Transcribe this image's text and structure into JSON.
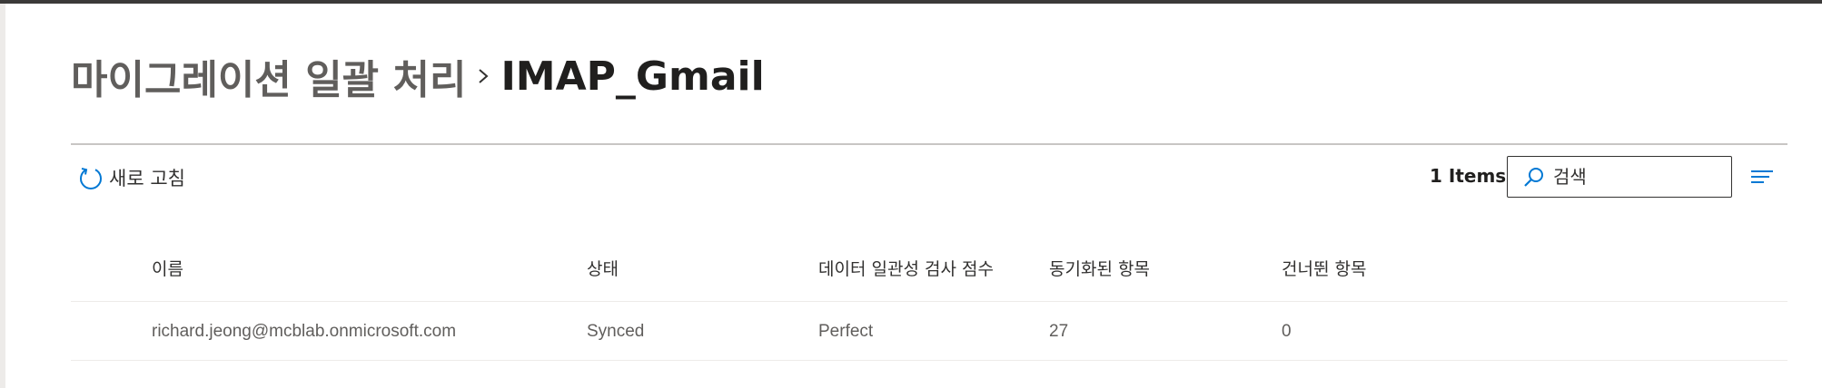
{
  "breadcrumb": {
    "parent": "마이그레이션 일괄 처리",
    "current": "IMAP_Gmail"
  },
  "toolbar": {
    "refresh_label": "새로 고침",
    "items_count": "1 Items",
    "search_placeholder": "검색"
  },
  "icons": {
    "refresh": "refresh-icon",
    "search": "search-icon",
    "filter": "filter-icon",
    "separator": "chevron-right-icon"
  },
  "colors": {
    "accent": "#0078d4",
    "text": "#323130",
    "muted_text": "#605e5c"
  },
  "table": {
    "columns": [
      "이름",
      "상태",
      "데이터 일관성 검사 점수",
      "동기화된 항목",
      "건너뛴 항목"
    ],
    "rows": [
      [
        "richard.jeong@mcblab.onmicrosoft.com",
        "Synced",
        "Perfect",
        "27",
        "0"
      ]
    ]
  }
}
